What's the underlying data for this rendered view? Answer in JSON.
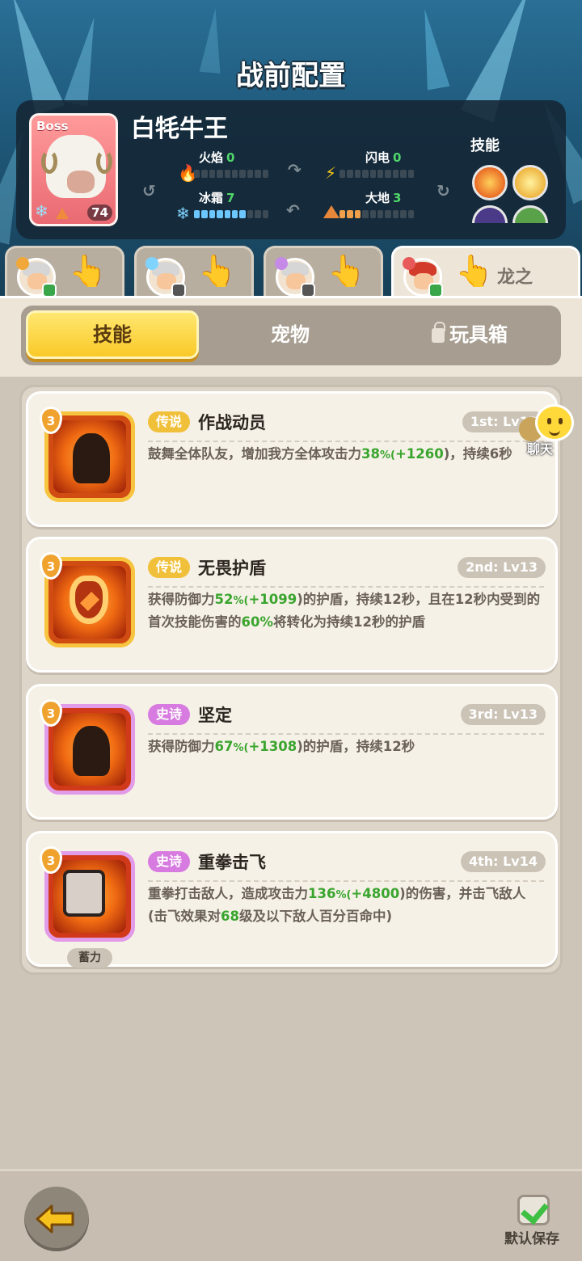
{
  "header": {
    "title": "战前配置"
  },
  "boss": {
    "tag": "Boss",
    "name": "白牦牛王",
    "level": "74",
    "stats": {
      "fire": {
        "label": "火焰",
        "value": "0"
      },
      "lightning": {
        "label": "闪电",
        "value": "0"
      },
      "frost": {
        "label": "冰霜",
        "value": "7"
      },
      "earth": {
        "label": "大地",
        "value": "3"
      }
    },
    "skills_label": "技能"
  },
  "character_tabs": [
    {
      "name": "hero-1",
      "active": false
    },
    {
      "name": "hero-2",
      "active": false
    },
    {
      "name": "hero-3",
      "active": false
    },
    {
      "name": "hero-4",
      "active": true,
      "label": "龙之"
    }
  ],
  "segments": {
    "skills": "技能",
    "pets": "宠物",
    "toybox": "玩具箱"
  },
  "skills": [
    {
      "rarity": "传说",
      "name": "作战动员",
      "rank": "1st: Lv13",
      "level_badge": "3",
      "desc_parts": [
        "鼓舞全体队友，增加我方全体攻击力",
        "38",
        "%(",
        "+1260",
        ")，持续6秒"
      ]
    },
    {
      "rarity": "传说",
      "name": "无畏护盾",
      "rank": "2nd: Lv13",
      "level_badge": "3",
      "desc_parts": [
        "获得防御力",
        "52",
        "%(",
        "+1099",
        ")的护盾，持续12秒，且在12秒内受到的首次技能伤害的",
        "60%",
        "将转化为持续12秒的护盾"
      ]
    },
    {
      "rarity": "史诗",
      "name": "坚定",
      "rank": "3rd: Lv13",
      "level_badge": "3",
      "desc_parts": [
        "获得防御力",
        "67",
        "%(",
        "+1308",
        ")的护盾，持续12秒"
      ]
    },
    {
      "rarity": "史诗",
      "name": "重拳击飞",
      "rank": "4th: Lv14",
      "level_badge": "3",
      "tag": "蓄力",
      "desc_parts": [
        "重拳打击敌人，造成攻击力",
        "136",
        "%(",
        "+4800",
        ")的伤害，并击飞敌人(击飞效果对",
        "68",
        "级及以下敌人百分百命中)"
      ]
    }
  ],
  "chat": {
    "label": "聊天"
  },
  "footer": {
    "save_label": "默认保存"
  },
  "colors": {
    "legend": "#f1c03a",
    "epic": "#d77be0",
    "highlight": "#3aa52e",
    "active_tab": "#f9c928"
  }
}
